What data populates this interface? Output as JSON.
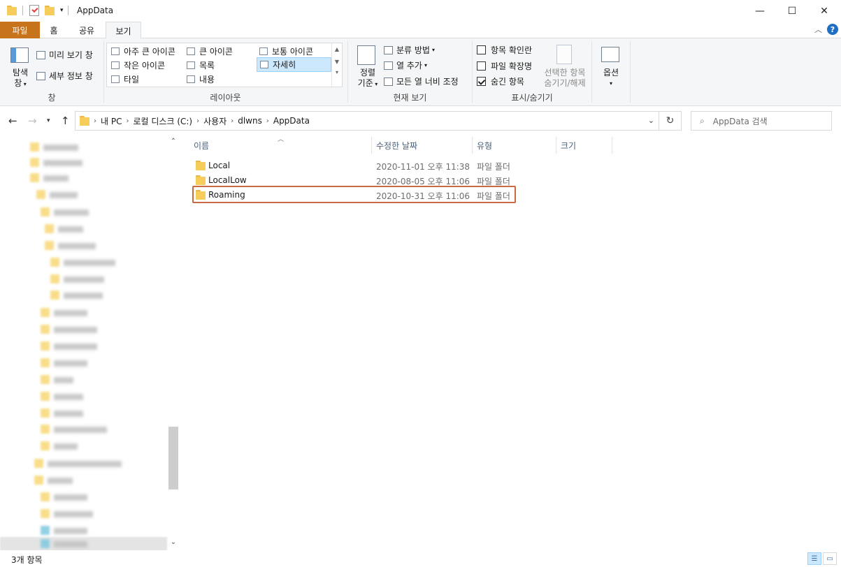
{
  "window": {
    "title": "AppData"
  },
  "controls": {
    "minimize": "—",
    "maximize": "☐",
    "close": "✕",
    "help": "?"
  },
  "tabs": [
    {
      "label": "파일"
    },
    {
      "label": "홈"
    },
    {
      "label": "공유"
    },
    {
      "label": "보기"
    }
  ],
  "ribbon": {
    "pane": {
      "nav_pane_line1": "탐색",
      "nav_pane_line2": "창",
      "preview": "미리 보기 창",
      "details": "세부 정보 창",
      "group": "창"
    },
    "layout": {
      "items": [
        "아주 큰 아이콘",
        "큰 아이콘",
        "보통 아이콘",
        "작은 아이콘",
        "목록",
        "자세히",
        "타일",
        "내용"
      ],
      "selected": "자세히",
      "group": "레이아웃"
    },
    "current_view": {
      "sort_line1": "정렬",
      "sort_line2": "기준",
      "group_by": "분류 방법",
      "add_columns": "열 추가",
      "fit_columns": "모든 열 너비 조정",
      "group": "현재 보기"
    },
    "show_hide": {
      "item_checkboxes": "항목 확인란",
      "item_checkboxes_checked": false,
      "extensions": "파일 확장명",
      "extensions_checked": false,
      "hidden": "숨긴 항목",
      "hidden_checked": true,
      "hide_selected_line1": "선택한 항목",
      "hide_selected_line2": "숨기기/해제",
      "group": "표시/숨기기"
    },
    "options": {
      "label": "옵션"
    }
  },
  "address": {
    "crumbs": [
      "내 PC",
      "로컬 디스크 (C:)",
      "사용자",
      "dlwns",
      "AppData"
    ]
  },
  "search": {
    "placeholder": "AppData 검색"
  },
  "columns": {
    "name": "이름",
    "date": "수정한 날짜",
    "type": "유형",
    "size": "크기"
  },
  "files": [
    {
      "name": "Local",
      "date": "2020-11-01 오후 11:38",
      "type": "파일 폴더"
    },
    {
      "name": "LocalLow",
      "date": "2020-08-05 오후 11:06",
      "type": "파일 폴더"
    },
    {
      "name": "Roaming",
      "date": "2020-10-31 오후 11:06",
      "type": "파일 폴더"
    }
  ],
  "highlighted_file": "Roaming",
  "status": {
    "count": "3개 항목"
  }
}
